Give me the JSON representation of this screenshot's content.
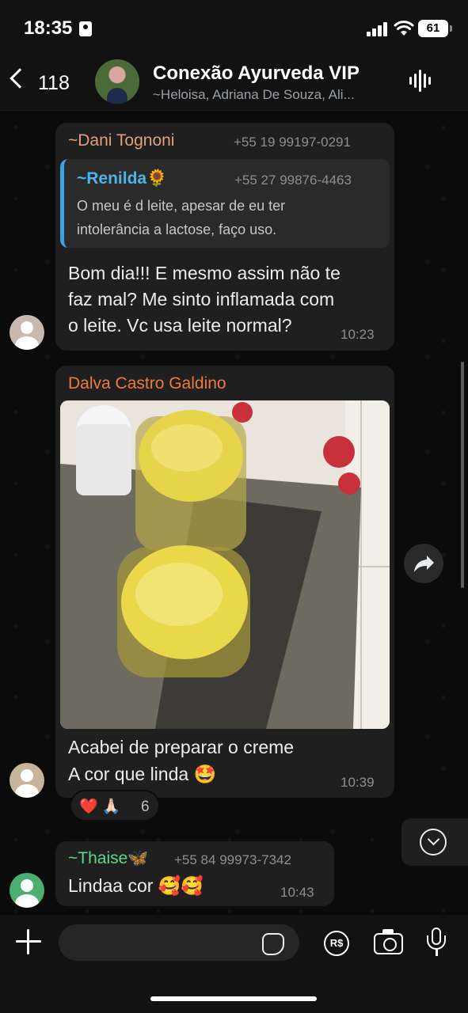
{
  "status_bar": {
    "time": "18:35",
    "battery": "61"
  },
  "header": {
    "back_count": "118",
    "title": "Conexão Ayurveda VIP",
    "members": "~Heloisa, Adriana De Souza, Ali..."
  },
  "messages": [
    {
      "sender": "~Dani Tognoni",
      "phone": "+55 19 99197-0291",
      "sender_color": "#e0a07a",
      "quoted": {
        "sender": "~Renilda🌻",
        "phone": "+55 27 99876-4463",
        "text_line1": "O meu é d leite, apesar de eu ter",
        "text_line2": "intolerância a lactose, faço uso."
      },
      "text_line1": "Bom dia!!! E mesmo assim não te",
      "text_line2": "faz mal? Me sinto inflamada com",
      "text_line3": "o leite. Vc usa leite normal?",
      "time": "10:23"
    },
    {
      "sender": "Dalva Castro Galdino",
      "sender_color": "#f07a3a",
      "text_line1": "Acabei de preparar o creme",
      "text_line2": "A cor que linda 🤩",
      "time": "10:39",
      "reactions": "❤️ 🙏🏻",
      "reaction_count": "6"
    },
    {
      "sender": "~Thaise🦋",
      "phone": "+55 84 99973-7342",
      "sender_color": "#5bd98a",
      "text": "Lindaa cor 🥰🥰",
      "time": "10:43"
    }
  ],
  "composer": {
    "placeholder": "",
    "pay_label": "R$"
  },
  "colors": {
    "background": "#0b0b0b",
    "bubble": "#1f1f1f",
    "quote_bar": "#3aa3e0",
    "quote_sender": "#4fb3e8"
  }
}
